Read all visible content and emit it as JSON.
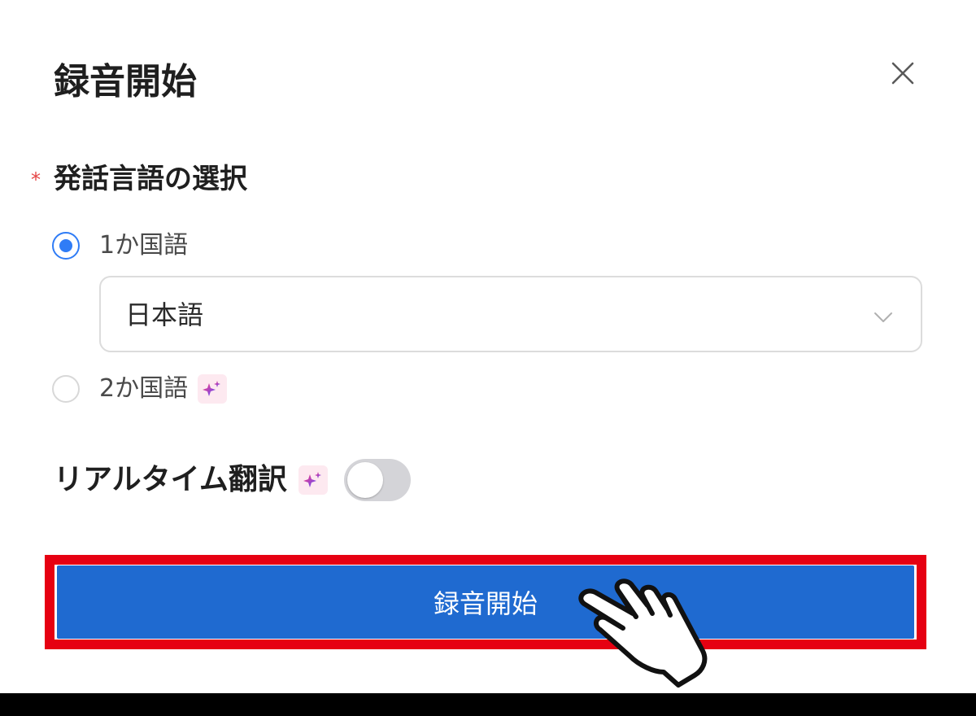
{
  "dialog": {
    "title": "録音開始",
    "close_icon": "close-icon"
  },
  "language_section": {
    "required_mark": "*",
    "label": "発話言語の選択",
    "options": [
      {
        "label": "1か国語",
        "selected": true
      },
      {
        "label": "2か国語",
        "selected": false,
        "badge_icon": "ai-sparkle-icon"
      }
    ],
    "select": {
      "value": "日本語",
      "icon": "chevron-down-icon"
    }
  },
  "realtime_translation": {
    "label": "リアルタイム翻訳",
    "badge_icon": "ai-sparkle-icon",
    "enabled": false
  },
  "start_button": {
    "label": "録音開始"
  },
  "overlay": {
    "highlight_color": "#e60012",
    "pointer_icon": "hand-pointer-icon"
  },
  "colors": {
    "accent": "#2f7cf6",
    "button": "#1f6ad0",
    "required": "#e54545"
  }
}
